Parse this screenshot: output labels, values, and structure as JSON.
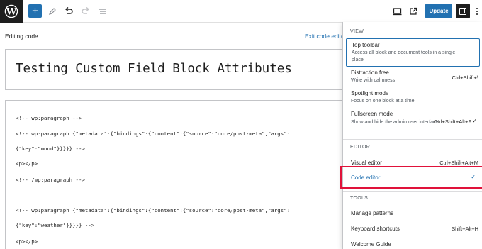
{
  "toolbar": {
    "update_label": "Update"
  },
  "icons": {
    "logo": "wordpress-logo-icon",
    "add": "plus-icon",
    "tools": "pencil-icon",
    "undo": "undo-icon",
    "redo": "redo-icon",
    "outline": "list-view-icon",
    "view": "desktop-icon",
    "preview": "external-link-icon",
    "settings": "sidebar-toggle-icon",
    "more": "more-vertical-icon"
  },
  "colors": {
    "accent": "#2271b1",
    "highlight": "#e0123a",
    "dark": "#1e1e1e"
  },
  "editor": {
    "editing_label": "Editing code",
    "exit_label": "Exit code editor",
    "title": "Testing Custom Field Block Attributes",
    "code_lines": [
      "<!-- wp:paragraph -->",
      "<!-- wp:paragraph {\"metadata\":{\"bindings\":{\"content\":{\"source\":\"core/post-meta\",\"args\":",
      "{\"key\":\"mood\"}}}}} -->",
      "<p></p>",
      "<!-- /wp:paragraph -->",
      "",
      "<!-- wp:paragraph {\"metadata\":{\"bindings\":{\"content\":{\"source\":\"core/post-meta\",\"args\":",
      "{\"key\":\"weather\"}}}}} -->",
      "<p></p>"
    ]
  },
  "menu": {
    "view_title": "VIEW",
    "view_items": [
      {
        "label": "Top toolbar",
        "desc": "Access all block and document tools in a single place",
        "shortcut": ""
      },
      {
        "label": "Distraction free",
        "desc": "Write with calmness",
        "shortcut": "Ctrl+Shift+\\"
      },
      {
        "label": "Spotlight mode",
        "desc": "Focus on one block at a time",
        "shortcut": ""
      },
      {
        "label": "Fullscreen mode",
        "desc": "Show and hide the admin user interface",
        "shortcut": "Ctrl+Shift+Alt+F"
      }
    ],
    "editor_title": "EDITOR",
    "editor_items": [
      {
        "label": "Visual editor",
        "shortcut": "Ctrl+Shift+Alt+M"
      },
      {
        "label": "Code editor",
        "shortcut": ""
      }
    ],
    "tools_title": "TOOLS",
    "tools_items": [
      {
        "label": "Manage patterns",
        "shortcut": ""
      },
      {
        "label": "Keyboard shortcuts",
        "shortcut": "Shift+Alt+H"
      },
      {
        "label": "Welcome Guide",
        "shortcut": ""
      }
    ]
  }
}
